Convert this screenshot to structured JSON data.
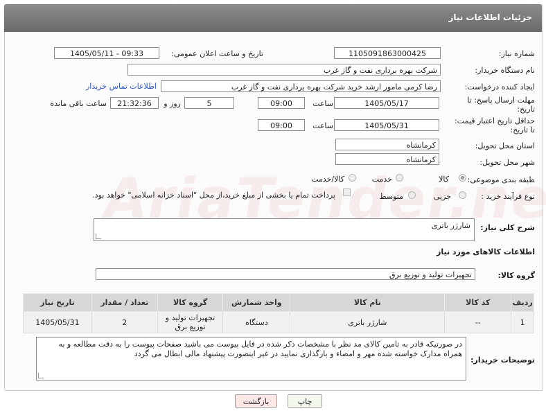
{
  "header": {
    "title": "جزئیات اطلاعات نیاز"
  },
  "watermark": "AriaTender.neT",
  "fields": {
    "need_number_label": "شماره نیاز:",
    "need_number": "1105091863000425",
    "announce_label": "تاریخ و ساعت اعلان عمومی:",
    "announce_value": "1405/05/11 - 09:33",
    "buyer_org_label": "نام دستگاه خریدار:",
    "buyer_org": "شرکت بهره برداری نفت و گاز غرب",
    "requester_label": "ایجاد کننده درخواست:",
    "requester": "رضا کرمی مامور ارشد خرید شرکت بهره برداری نفت و گاز غرب",
    "buyer_contact_link": "اطلاعات تماس خریدار",
    "deadline_label_1": "مهلت ارسال پاسخ: تا",
    "deadline_label_2": "تاریخ:",
    "deadline_date": "1405/05/17",
    "time_label": "ساعت",
    "deadline_time": "09:00",
    "days_count": "5",
    "days_label": "روز و",
    "remaining_time": "21:32:36",
    "remaining_label": "ساعت باقی مانده",
    "price_validity_label_1": "حداقل تاریخ اعتبار قیمت:",
    "price_validity_label_2": "تا تاریخ:",
    "price_validity_date": "1405/05/31",
    "price_validity_time": "09:00",
    "province_label": "استان محل تحویل:",
    "province": "کرمانشاه",
    "city_label": "شهر محل تحویل:",
    "city": "کرمانشاه",
    "category_label": "طبقه بندی موضوعی:",
    "category_options": [
      "کالا",
      "خدمت",
      "کالا/خدمت"
    ],
    "process_label": "نوع فرآیند خرید :",
    "process_options": [
      "جزیی",
      "متوسط"
    ],
    "payment_note": "پرداخت تمام یا بخشی از مبلغ خرید،از محل \"اسناد خزانه اسلامی\" خواهد بود.",
    "description_label": "شرح کلی نیاز:",
    "description": "شارژر باتری",
    "goods_info_title": "اطلاعات کالاهای مورد نیاز",
    "goods_group_label": "گروه کالا:",
    "goods_group": "تجهیزات تولید و توزیع برق",
    "buyer_notes_label": "توضیحات خریدار:",
    "buyer_notes": "در صورتیکه قادر به تامین کالای مد نظر با مشخصات ذکر شده در فایل پیوست می باشید صفحات پیوست را به دقت مطالعه و به همراه مدارک خواسته شده مهر و امضاء و بارگذاری نمایید در غیر اینصورت پیشنهاد مالی ابطال می گردد"
  },
  "table": {
    "headers": [
      "ردیف",
      "کد کالا",
      "نام کالا",
      "واحد شمارش",
      "گروه کالا",
      "تعداد / مقدار",
      "تاریخ نیاز"
    ],
    "rows": [
      [
        "1",
        "--",
        "شارژر باتری",
        "دستگاه",
        "تجهیزات تولید و توزیع برق",
        "2",
        "1405/05/31"
      ]
    ]
  },
  "buttons": {
    "print": "چاپ",
    "back": "بازگشت"
  }
}
